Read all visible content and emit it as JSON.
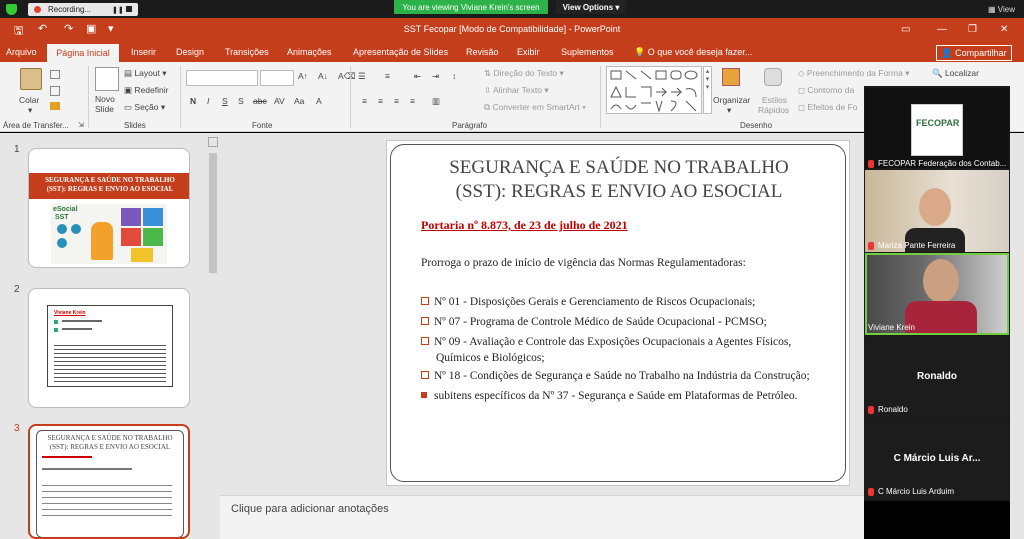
{
  "meeting": {
    "recording_label": "Recording...",
    "viewing_banner": "You are viewing Viviane Krein's screen",
    "view_options": "View Options",
    "view_button": "View"
  },
  "window": {
    "title": "SST Fecopar [Modo de Compatibilidade] - PowerPoint"
  },
  "ribbon_tabs": [
    "Arquivo",
    "Página Inicial",
    "Inserir",
    "Design",
    "Transições",
    "Animações",
    "Apresentação de Slides",
    "Revisão",
    "Exibir",
    "Suplementos"
  ],
  "tell_me": "O que você deseja fazer...",
  "share_label": "Compartilhar",
  "ribbon": {
    "paste": "Colar",
    "new_slide": "Novo",
    "new_slide_2": "Slide",
    "layout": "Layout",
    "reset": "Redefinir",
    "section": "Seção",
    "text_direction": "Direção do Texto",
    "align_text": "Alinhar Texto",
    "smartart": "Converter em SmartArt",
    "arrange": "Organizar",
    "quick_styles": "Estilos",
    "quick_styles_2": "Rápidos",
    "shape_fill": "Preenchimento da Forma",
    "shape_outline": "Contorno da",
    "shape_effects": "Efeitos de Fo",
    "find": "Localizar",
    "groups": [
      "Área de Transfer...",
      "Slides",
      "Fonte",
      "Parágrafo",
      "Desenho"
    ]
  },
  "thumbnails": [
    {
      "number": "1",
      "title": "SEGURANÇA E SAÚDE NO TRABALHO (SST): REGRAS E ENVIO AO ESOCIAL",
      "logo": "eSocial",
      "logo_sub": "SST"
    },
    {
      "number": "2",
      "name": "Viviane Krein"
    },
    {
      "number": "3",
      "title": "SEGURANÇA E SAÚDE NO TRABALHO (SST): REGRAS E ENVIO AO ESOCIAL"
    }
  ],
  "slide": {
    "title_line1": "SEGURANÇA E SAÚDE NO TRABALHO",
    "title_line2": "(SST): REGRAS E ENVIO AO ESOCIAL",
    "portaria": "Portaria nº 8.873, de 23 de julho de 2021",
    "intro": "Prorroga o prazo de início de vigência das Normas Regulamentadoras:",
    "bullets": [
      "Nº 01 - Disposições Gerais e Gerenciamento de Riscos Ocupacionais;",
      "Nº 07 - Programa de Controle Médico de Saúde Ocupacional - PCMSO;",
      "Nº 09 - Avaliação e Controle das Exposições Ocupacionais a Agentes Físicos,",
      "Químicos e Biológicos;",
      "Nº 18 - Condições de Segurança e Saúde no Trabalho na Indústria da Construção;",
      "subitens específicos da Nº 37 - Segurança e Saúde em Plataformas de Petróleo."
    ]
  },
  "notes_placeholder": "Clique para adicionar anotações",
  "participants": [
    {
      "name": "FECOPAR Federação dos Contab...",
      "logo": "FECOPAR"
    },
    {
      "name": "Mariza Pante Ferreira"
    },
    {
      "name": "Viviane Krein"
    },
    {
      "name": "Ronaldo",
      "display": "Ronaldo"
    },
    {
      "name": "C Márcio Luis Arduim",
      "display": "C Márcio Luis Ar..."
    }
  ],
  "colors": {
    "accent": "#c43e1c",
    "link_red": "#c00000",
    "banner_green": "#2db24a"
  }
}
